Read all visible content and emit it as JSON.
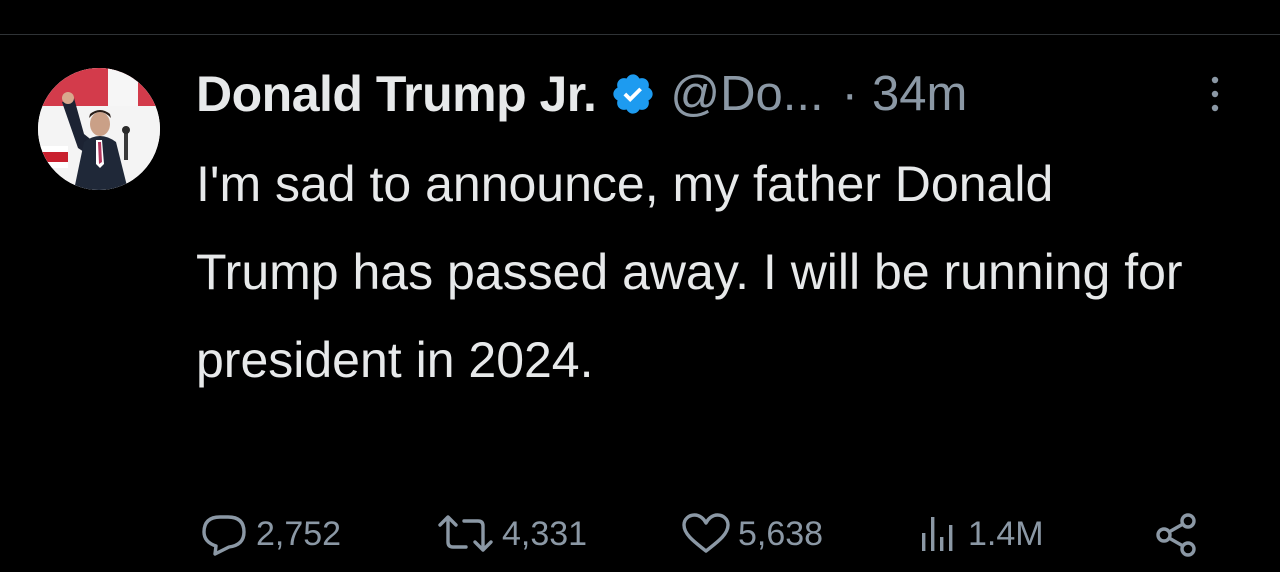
{
  "tweet": {
    "author": {
      "display_name": "Donald Trump Jr.",
      "handle": "@Do...",
      "verified": true,
      "avatar_icon": "profile-photo"
    },
    "separator": "·",
    "timestamp": "34m",
    "text": "I'm sad to announce, my father Donald Trump has passed away. I will be running for president in 2024."
  },
  "actions": {
    "reply": {
      "icon": "reply-icon",
      "count": "2,752"
    },
    "retweet": {
      "icon": "retweet-icon",
      "count": "4,331"
    },
    "like": {
      "icon": "heart-icon",
      "count": "5,638"
    },
    "views": {
      "icon": "views-icon",
      "count": "1.4M"
    },
    "share": {
      "icon": "share-icon"
    }
  },
  "colors": {
    "background": "#000000",
    "text_primary": "#e7e9ea",
    "text_secondary": "#8b98a5",
    "verified_badge": "#1d9bf0",
    "divider": "#2f3336"
  }
}
